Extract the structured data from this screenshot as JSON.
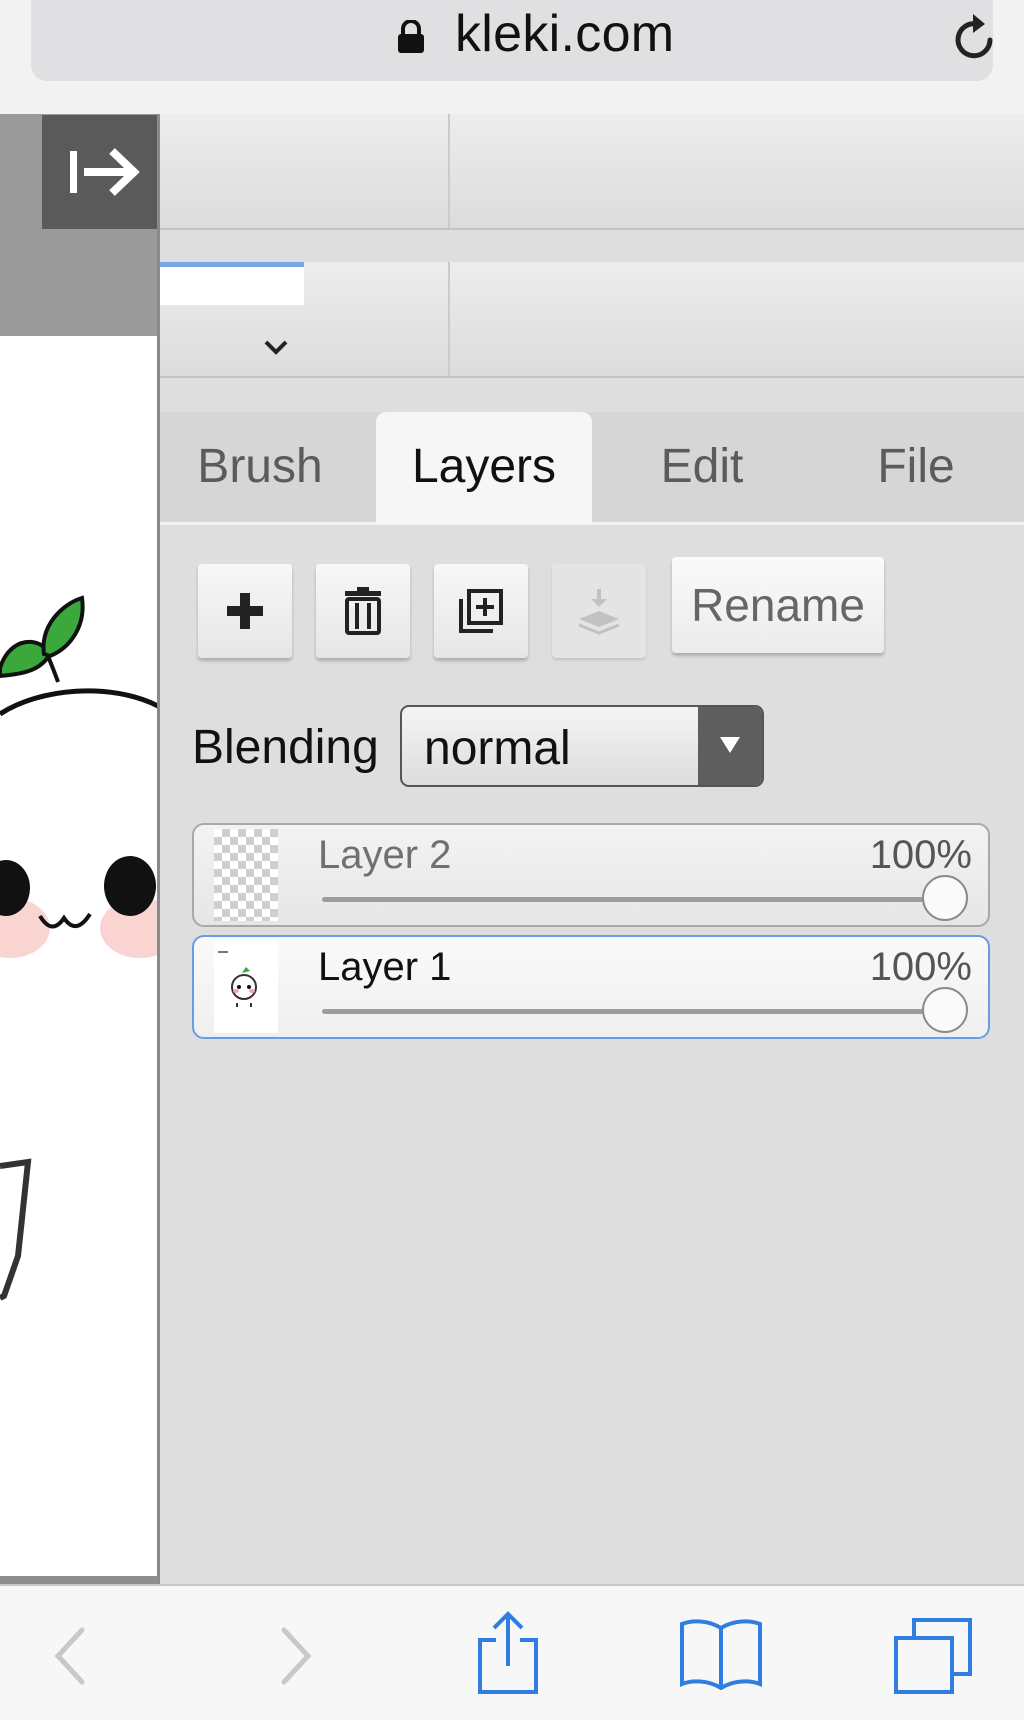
{
  "browser": {
    "url": "kleki.com",
    "icons": [
      "lock-icon",
      "reload-icon",
      "back-icon",
      "forward-icon",
      "share-icon",
      "bookmarks-icon",
      "tabs-icon"
    ]
  },
  "sidebar": {
    "collapse_icon": "collapse-panel-icon"
  },
  "tool_panel": {
    "color_accent": "#7aa4e6"
  },
  "tabs": [
    {
      "label": "Brush",
      "active": false
    },
    {
      "label": "Layers",
      "active": true
    },
    {
      "label": "Edit",
      "active": false
    },
    {
      "label": "File",
      "active": false
    }
  ],
  "layer_actions": {
    "icons": [
      "add-layer-icon",
      "delete-layer-icon",
      "duplicate-layer-icon",
      "merge-down-icon"
    ],
    "rename_label": "Rename"
  },
  "blending": {
    "label": "Blending",
    "value": "normal"
  },
  "layers": [
    {
      "name": "Layer 2",
      "opacity": "100%",
      "opacity_value": 1.0,
      "selected": false
    },
    {
      "name": "Layer 1",
      "opacity": "100%",
      "opacity_value": 1.0,
      "selected": true
    }
  ],
  "colors": {
    "selection_border": "#6a9be6",
    "leaf_green": "#3aa83a"
  }
}
